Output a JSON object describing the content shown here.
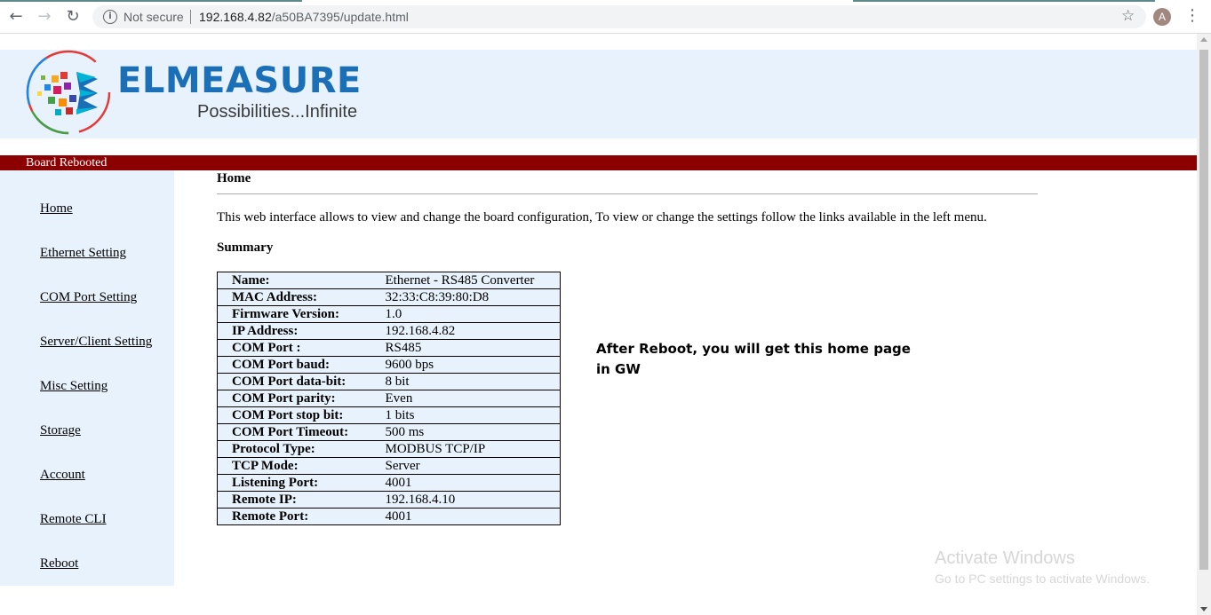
{
  "browser": {
    "security_label": "Not secure",
    "url_host": "192.168.4.82",
    "url_path": "/a50BA7395/update.html",
    "avatar_letter": "A",
    "icons": [
      "back-arrow-icon",
      "forward-arrow-icon",
      "reload-icon",
      "info-icon",
      "bookmark-star-icon",
      "avatar",
      "more-menu-icon"
    ]
  },
  "header": {
    "brand": "ELMEASURE",
    "tagline": "Possibilities...Infinite",
    "brand_color": "#1a6fb6"
  },
  "status_bar": {
    "text": "Board Rebooted",
    "color": "#8b0000"
  },
  "sidebar": {
    "items": [
      {
        "label": "Home"
      },
      {
        "label": "Ethernet Setting"
      },
      {
        "label": "COM Port Setting"
      },
      {
        "label": "Server/Client Setting"
      },
      {
        "label": "Misc Setting"
      },
      {
        "label": "Storage"
      },
      {
        "label": "Account"
      },
      {
        "label": "Remote CLI"
      },
      {
        "label": "Reboot"
      }
    ]
  },
  "main": {
    "title": "Home",
    "intro": "This web interface allows to view and change the board configuration, To view or change the settings follow the links available in the left menu.",
    "summary_heading": "Summary",
    "summary_rows": [
      {
        "key": "Name:",
        "value": "Ethernet - RS485 Converter"
      },
      {
        "key": "MAC Address:",
        "value": "32:33:C8:39:80:D8"
      },
      {
        "key": "Firmware Version:",
        "value": "1.0"
      },
      {
        "key": "IP Address:",
        "value": "192.168.4.82"
      },
      {
        "key": "COM Port :",
        "value": "RS485"
      },
      {
        "key": "COM Port baud:",
        "value": "9600 bps"
      },
      {
        "key": "COM Port data-bit:",
        "value": "8 bit"
      },
      {
        "key": "COM Port parity:",
        "value": "Even"
      },
      {
        "key": "COM Port stop bit:",
        "value": "1 bits"
      },
      {
        "key": "COM Port Timeout:",
        "value": "500 ms"
      },
      {
        "key": "Protocol Type:",
        "value": "MODBUS TCP/IP"
      },
      {
        "key": "TCP Mode:",
        "value": "Server"
      },
      {
        "key": "Listening Port:",
        "value": "4001"
      },
      {
        "key": "Remote IP:",
        "value": "192.168.4.10"
      },
      {
        "key": "Remote Port:",
        "value": "4001"
      }
    ]
  },
  "annotation": {
    "text": "After Reboot, you will get this home page in GW"
  },
  "watermark": {
    "line1": "Activate Windows",
    "line2": "Go to PC settings to activate Windows."
  }
}
